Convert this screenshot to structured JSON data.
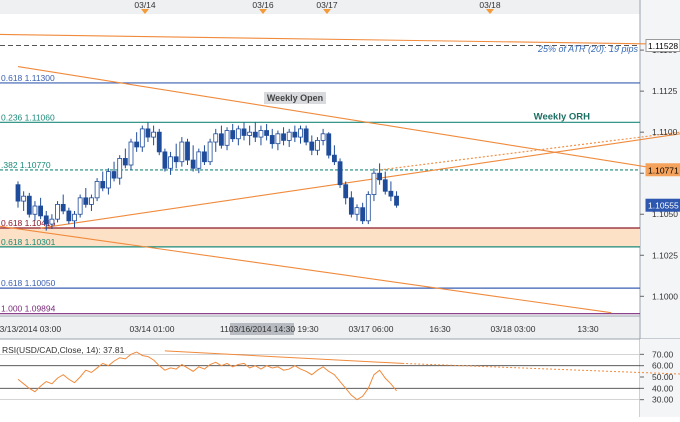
{
  "chart_data": [
    {
      "type": "candlestick",
      "instrument": "USD/CAD",
      "top_dates": [
        "03/14",
        "03/16",
        "03/17",
        "03/18"
      ],
      "x_tick_labels": [
        "03/13/2014 03:00",
        "03/14 01:00",
        "11:3",
        "03/16/2014 14:30",
        "19:30",
        "03/17 06:00",
        "16:30",
        "03/18 03:00",
        "13:30"
      ],
      "y_ticks": [
        1.115,
        1.1125,
        1.11,
        1.1075,
        1.105,
        1.1025,
        1.1
      ],
      "ylim": [
        1.0988,
        1.1172
      ],
      "price_tags": [
        {
          "label": "1.11528",
          "value": 1.11528,
          "bg": "#ffffff",
          "color": "#000000"
        },
        {
          "label": "1.10771",
          "value": 1.10771,
          "bg": "#f5a35c",
          "color": "#000000"
        },
        {
          "label": "1.10555",
          "value": 1.10555,
          "bg": "#2e58b0",
          "color": "#ffffff"
        }
      ],
      "levels": [
        {
          "label": "0.618",
          "price_label": "1.11300",
          "value": 1.113,
          "color": "#3a5fb0",
          "style": "solid"
        },
        {
          "label": "0.236",
          "price_label": "1.11060",
          "value": 1.1106,
          "color": "#1b8a7a",
          "style": "solid"
        },
        {
          "label": ".382",
          "price_label": "1.10770",
          "value": 1.1077,
          "color": "#1b8a7a",
          "style": "dashed"
        },
        {
          "label": "0.618",
          "price_label": "1.10416",
          "value": 1.10416,
          "color": "#8b1a2b",
          "style": "solid"
        },
        {
          "label": "0.618",
          "price_label": "1.10301",
          "value": 1.10301,
          "color": "#1b8a7a",
          "style": "solid"
        },
        {
          "label": "0.618",
          "price_label": "1.10050",
          "value": 1.1005,
          "color": "#3a5fb0",
          "style": "solid"
        },
        {
          "label": "1.000",
          "price_label": "1.09894",
          "value": 1.09894,
          "color": "#7a2a7a",
          "style": "solid"
        }
      ],
      "zone": {
        "from": 1.10301,
        "to": 1.10416,
        "color": "#fde1c6"
      },
      "annotations": {
        "atr": "25% of ATR (20): 19 pips",
        "weekly_open": "Weekly Open",
        "weekly_orh": "Weekly ORH"
      },
      "candles": [
        [
          1.1068,
          1.107,
          1.1054,
          1.1058
        ],
        [
          1.1058,
          1.1064,
          1.1052,
          1.1061
        ],
        [
          1.1061,
          1.1063,
          1.1048,
          1.105
        ],
        [
          1.105,
          1.1058,
          1.1046,
          1.1055
        ],
        [
          1.1055,
          1.106,
          1.1047,
          1.1049
        ],
        [
          1.1049,
          1.1052,
          1.104,
          1.1044
        ],
        [
          1.1044,
          1.105,
          1.1041,
          1.1047
        ],
        [
          1.1047,
          1.1058,
          1.1045,
          1.1056
        ],
        [
          1.1056,
          1.1062,
          1.105,
          1.1052
        ],
        [
          1.1052,
          1.1054,
          1.1044,
          1.1046
        ],
        [
          1.1046,
          1.1052,
          1.1042,
          1.105
        ],
        [
          1.105,
          1.1062,
          1.1048,
          1.106
        ],
        [
          1.106,
          1.1066,
          1.1054,
          1.1056
        ],
        [
          1.1056,
          1.1062,
          1.1052,
          1.106
        ],
        [
          1.106,
          1.1072,
          1.1058,
          1.107
        ],
        [
          1.107,
          1.1076,
          1.1064,
          1.1066
        ],
        [
          1.1066,
          1.1078,
          1.1062,
          1.1076
        ],
        [
          1.1076,
          1.1082,
          1.107,
          1.1072
        ],
        [
          1.1072,
          1.1086,
          1.1068,
          1.1084
        ],
        [
          1.1084,
          1.109,
          1.1078,
          1.108
        ],
        [
          1.108,
          1.1096,
          1.1077,
          1.1094
        ],
        [
          1.1094,
          1.11,
          1.1088,
          1.1091
        ],
        [
          1.1091,
          1.1104,
          1.1088,
          1.1102
        ],
        [
          1.1102,
          1.1106,
          1.1094,
          1.1097
        ],
        [
          1.1097,
          1.1104,
          1.1092,
          1.11
        ],
        [
          1.11,
          1.1102,
          1.1086,
          1.1088
        ],
        [
          1.1088,
          1.109,
          1.1076,
          1.1078
        ],
        [
          1.1078,
          1.1088,
          1.1074,
          1.1085
        ],
        [
          1.1085,
          1.1093,
          1.1078,
          1.1082
        ],
        [
          1.1082,
          1.1097,
          1.1079,
          1.1094
        ],
        [
          1.1094,
          1.1096,
          1.108,
          1.1083
        ],
        [
          1.1083,
          1.1092,
          1.1076,
          1.1078
        ],
        [
          1.1078,
          1.109,
          1.1075,
          1.1088
        ],
        [
          1.1088,
          1.1092,
          1.108,
          1.1082
        ],
        [
          1.1082,
          1.1096,
          1.108,
          1.1094
        ],
        [
          1.1094,
          1.1102,
          1.1088,
          1.1099
        ],
        [
          1.1099,
          1.1104,
          1.109,
          1.1092
        ],
        [
          1.1092,
          1.1103,
          1.1089,
          1.1101
        ],
        [
          1.1101,
          1.1105,
          1.1094,
          1.1096
        ],
        [
          1.1096,
          1.1104,
          1.1092,
          1.1102
        ],
        [
          1.1102,
          1.1106,
          1.1095,
          1.1098
        ],
        [
          1.1098,
          1.1104,
          1.1092,
          1.11
        ],
        [
          1.11,
          1.1106,
          1.1094,
          1.1097
        ],
        [
          1.1097,
          1.1104,
          1.1092,
          1.1101
        ],
        [
          1.1101,
          1.1105,
          1.1095,
          1.1098
        ],
        [
          1.1098,
          1.1102,
          1.109,
          1.1093
        ],
        [
          1.1093,
          1.1101,
          1.1089,
          1.1099
        ],
        [
          1.1099,
          1.1103,
          1.1092,
          1.1095
        ],
        [
          1.1095,
          1.1102,
          1.1091,
          1.11
        ],
        [
          1.11,
          1.1104,
          1.1094,
          1.1097
        ],
        [
          1.1097,
          1.1104,
          1.1093,
          1.1102
        ],
        [
          1.1102,
          1.1104,
          1.1092,
          1.1094
        ],
        [
          1.1094,
          1.1098,
          1.1086,
          1.1089
        ],
        [
          1.1089,
          1.1097,
          1.1086,
          1.1095
        ],
        [
          1.1095,
          1.1102,
          1.1092,
          1.1099
        ],
        [
          1.1099,
          1.11,
          1.1084,
          1.1086
        ],
        [
          1.1086,
          1.1092,
          1.108,
          1.1082
        ],
        [
          1.1082,
          1.1084,
          1.1066,
          1.1068
        ],
        [
          1.1068,
          1.107,
          1.1056,
          1.106
        ],
        [
          1.106,
          1.1064,
          1.1048,
          1.105
        ],
        [
          1.105,
          1.1056,
          1.1046,
          1.1054
        ],
        [
          1.1054,
          1.1057,
          1.1044,
          1.1046
        ],
        [
          1.1046,
          1.1064,
          1.1044,
          1.1062
        ],
        [
          1.1062,
          1.1078,
          1.1058,
          1.1075
        ],
        [
          1.1075,
          1.1081,
          1.1068,
          1.1071
        ],
        [
          1.1071,
          1.1076,
          1.1062,
          1.1064
        ],
        [
          1.1064,
          1.107,
          1.1058,
          1.1061
        ],
        [
          1.1061,
          1.1064,
          1.1054,
          1.10555
        ]
      ],
      "trendlines": [
        {
          "from": [
            0,
            1.114
          ],
          "to": [
            131,
            1.1068
          ],
          "color": "#f08a3c",
          "style": "solid"
        },
        {
          "from": [
            4,
            1.10416
          ],
          "to": [
            131,
            1.1106
          ],
          "color": "#f08a3c",
          "style": "solid"
        },
        {
          "from": [
            -12,
            1.116
          ],
          "to": [
            131,
            1.11528
          ],
          "color": "#f08a3c",
          "style": "solid"
        },
        {
          "from": [
            -8,
            1.1045
          ],
          "to": [
            105,
            1.099
          ],
          "color": "#f08a3c",
          "style": "solid"
        }
      ],
      "orh_line": {
        "from": [
          72,
          1.1106
        ],
        "to": [
          131,
          1.1106
        ],
        "color": "#1b8a7a"
      }
    },
    {
      "type": "line",
      "title": "RSI(USD/CAD,Close, 14): 37.81",
      "ylim": [
        20,
        80
      ],
      "y_ticks": [
        70,
        60,
        50,
        40,
        30
      ],
      "levels": [
        60,
        40
      ],
      "series": [
        {
          "values": [
            48,
            44,
            40,
            37,
            42,
            46,
            44,
            49,
            52,
            48,
            45,
            50,
            56,
            54,
            58,
            62,
            60,
            64,
            67,
            66,
            70,
            72,
            69,
            68,
            65,
            60,
            56,
            58,
            57,
            61,
            58,
            55,
            59,
            57,
            61,
            63,
            60,
            62,
            59,
            61,
            62,
            58,
            60,
            57,
            60,
            58,
            59,
            56,
            57,
            60,
            57,
            55,
            52,
            56,
            59,
            55,
            52,
            46,
            40,
            34,
            30,
            33,
            40,
            52,
            56,
            49,
            44,
            37.81
          ],
          "color": "#f08a3c"
        }
      ],
      "trendline": {
        "from": [
          26,
          73
        ],
        "to": [
          131,
          50
        ]
      }
    }
  ]
}
